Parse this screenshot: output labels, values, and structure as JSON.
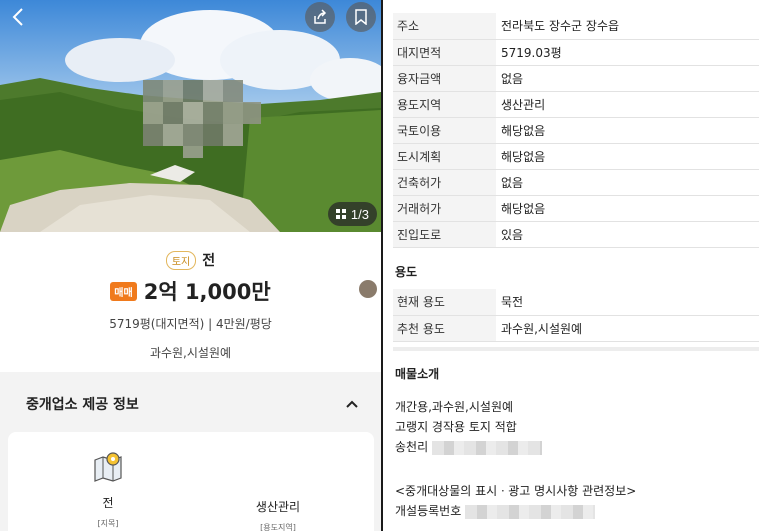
{
  "listing": {
    "category_tag": "토지",
    "category_value": "전",
    "sale_badge": "매매",
    "price": "2억 1,000만",
    "area_line": "5719평(대지면적) | 4만원/평당",
    "recommended_use": "과수원,시설원예",
    "photo_counter": "1/3"
  },
  "agency": {
    "title": "중개업소 제공 정보",
    "cards": [
      {
        "value": "전",
        "sub": "[지목]"
      },
      {
        "value": "생산관리",
        "sub": "[용도지역]"
      }
    ]
  },
  "details": {
    "rows": [
      {
        "label": "주소",
        "value": "전라북도 장수군 장수읍"
      },
      {
        "label": "대지면적",
        "value": "5719.03평"
      },
      {
        "label": "융자금액",
        "value": "없음"
      },
      {
        "label": "용도지역",
        "value": "생산관리"
      },
      {
        "label": "국토이용",
        "value": "해당없음"
      },
      {
        "label": "도시계획",
        "value": "해당없음"
      },
      {
        "label": "건축허가",
        "value": "없음"
      },
      {
        "label": "거래허가",
        "value": "해당없음"
      },
      {
        "label": "진입도로",
        "value": "있음"
      }
    ]
  },
  "usage": {
    "title": "용도",
    "rows": [
      {
        "label": "현재 용도",
        "value": "묵전"
      },
      {
        "label": "추천 용도",
        "value": "과수원,시설원예"
      }
    ]
  },
  "intro": {
    "title": "매물소개",
    "line1": "개간용,과수원,시설원예",
    "line2": "고랭지 경작용 토지 적합",
    "line3_prefix": "송천리",
    "notice": "<중개대상물의 표시ㆍ광고 명시사항 관련정보>",
    "reg_label": "개설등록번호"
  },
  "colors": {
    "accent_orange": "#f07a1c",
    "tag_gold": "#e3b75d",
    "label_bg": "#f4f4f4"
  }
}
